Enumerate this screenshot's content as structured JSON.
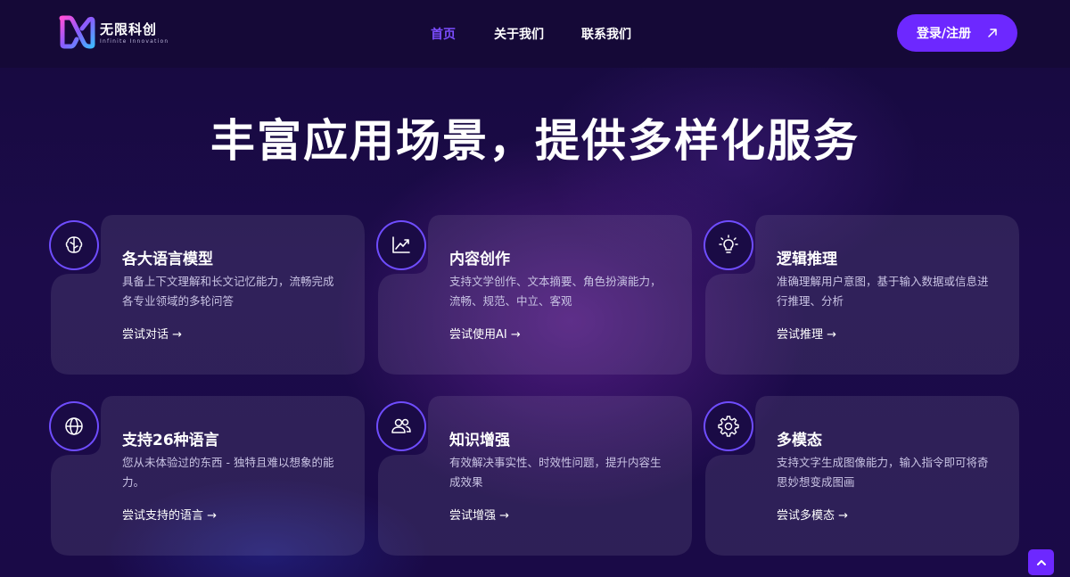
{
  "brand": {
    "name": "无限科创",
    "tagline": "Infinite Innovation"
  },
  "nav": {
    "items": [
      {
        "label": "首页",
        "active": true
      },
      {
        "label": "关于我们",
        "active": false
      },
      {
        "label": "联系我们",
        "active": false
      }
    ],
    "login_label": "登录/注册"
  },
  "headline": "丰富应用场景，提供多样化服务",
  "cards": [
    {
      "icon": "brain-icon",
      "title": "各大语言模型",
      "desc": "具备上下文理解和长文记忆能力，流畅完成各专业领域的多轮问答",
      "link": "尝试对话"
    },
    {
      "icon": "chart-trend-icon",
      "title": "内容创作",
      "desc": "支持文学创作、文本摘要、角色扮演能力，流畅、规范、中立、客观",
      "link": "尝试使用AI"
    },
    {
      "icon": "lightbulb-icon",
      "title": "逻辑推理",
      "desc": "准确理解用户意图，基于输入数据或信息进行推理、分析",
      "link": "尝试推理"
    },
    {
      "icon": "globe-icon",
      "title": "支持26种语言",
      "desc": "您从未体验过的东西 - 独特且难以想象的能力。",
      "link": "尝试支持的语言"
    },
    {
      "icon": "users-icon",
      "title": "知识增强",
      "desc": "有效解决事实性、时效性问题，提升内容生成效果",
      "link": "尝试增强"
    },
    {
      "icon": "gear-icon",
      "title": "多模态",
      "desc": "支持文字生成图像能力，输入指令即可将奇思妙想变成图画",
      "link": "尝试多模态"
    }
  ],
  "colors": {
    "accent": "#6d28ff",
    "nav_active": "#7c4dff",
    "background": "#1c0b4a"
  },
  "scroll_top_icon": "chevron-up-icon"
}
